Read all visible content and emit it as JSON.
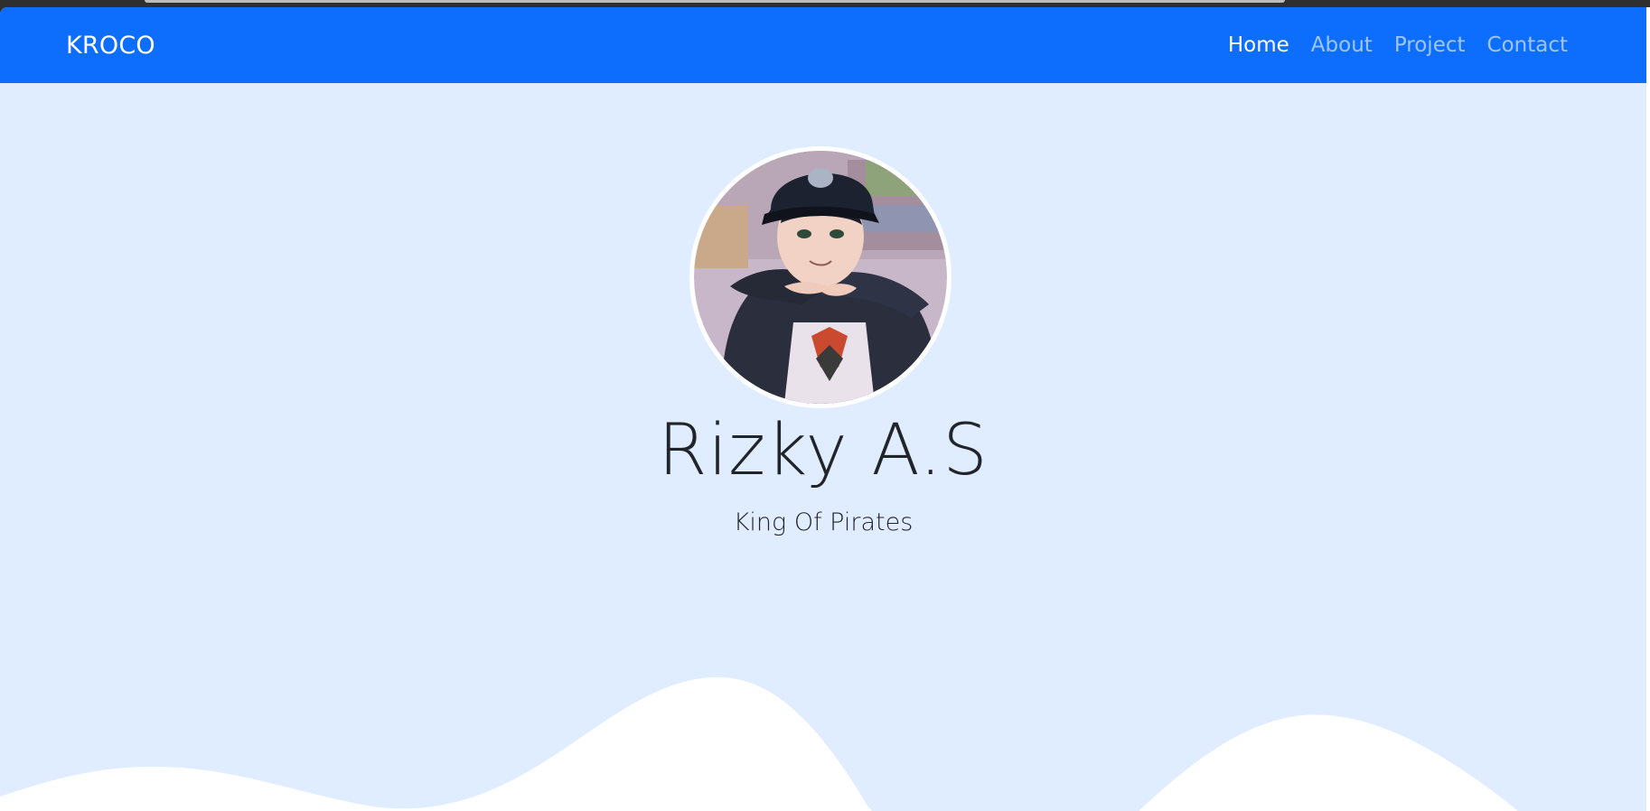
{
  "navbar": {
    "brand": "KROCO",
    "links": [
      {
        "label": "Home",
        "active": true
      },
      {
        "label": "About",
        "active": false
      },
      {
        "label": "Project",
        "active": false
      },
      {
        "label": "Contact",
        "active": false
      }
    ]
  },
  "hero": {
    "name": "Rizky A.S",
    "tagline": "King Of Pirates",
    "avatar_icon": "profile-avatar-illustration"
  },
  "colors": {
    "navbar_bg": "#0d6efd",
    "hero_bg": "#e0ecff",
    "wave": "#ffffff",
    "text": "#212529"
  }
}
